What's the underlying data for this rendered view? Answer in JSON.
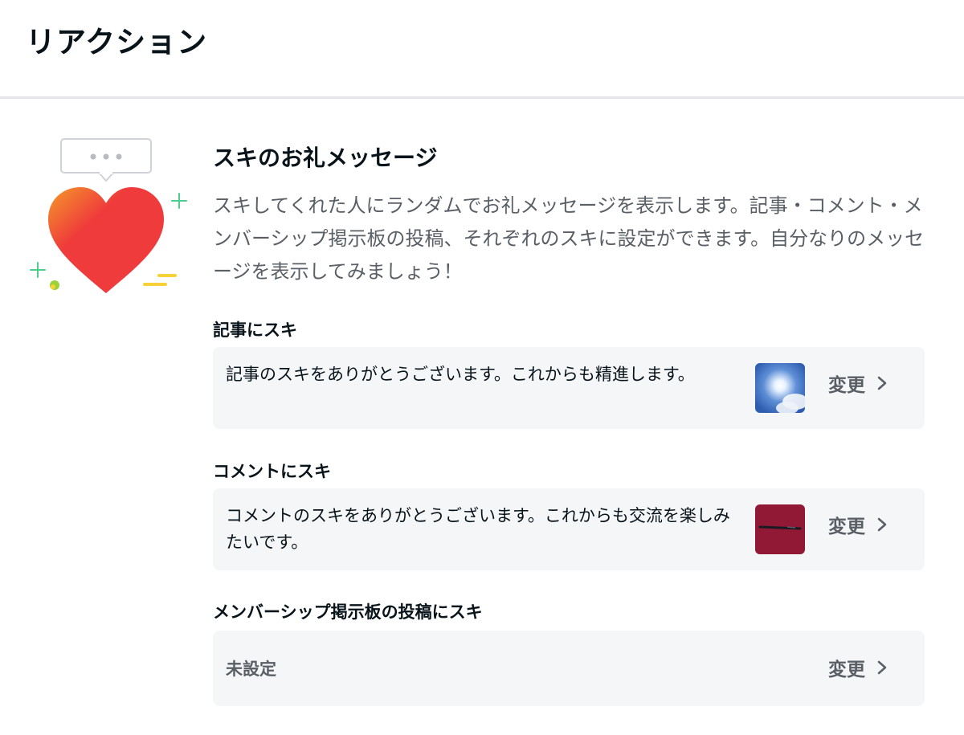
{
  "page": {
    "title": "リアクション"
  },
  "section": {
    "title": "スキのお礼メッセージ",
    "description": "スキしてくれた人にランダムでお礼メッセージを表示します。記事・コメント・メンバーシップ掲示板の投稿、それぞれのスキに設定ができます。自分なりのメッセージを表示してみましょう！"
  },
  "groups": [
    {
      "label": "記事にスキ",
      "message": "記事のスキをありがとうございます。これからも精進します。",
      "thumbnail": "sky-sun-photo",
      "change_label": "変更"
    },
    {
      "label": "コメントにスキ",
      "message": "コメントのスキをありがとうございます。これからも交流を楽しみたいです。",
      "thumbnail": "pen-on-red-photo",
      "change_label": "変更"
    },
    {
      "label": "メンバーシップ掲示板の投稿にスキ",
      "message": "未設定",
      "change_label": "変更"
    }
  ],
  "icons": {
    "illustration": "heart-with-speech-bubble-icon",
    "chevron": "chevron-right-icon"
  },
  "colors": {
    "heart": "#ef3b3b",
    "card_bg": "#f5f6f8",
    "muted_text": "#5a5f66",
    "sparkle_green": "#4ccf8c",
    "accent_yellow": "#f7d236"
  }
}
